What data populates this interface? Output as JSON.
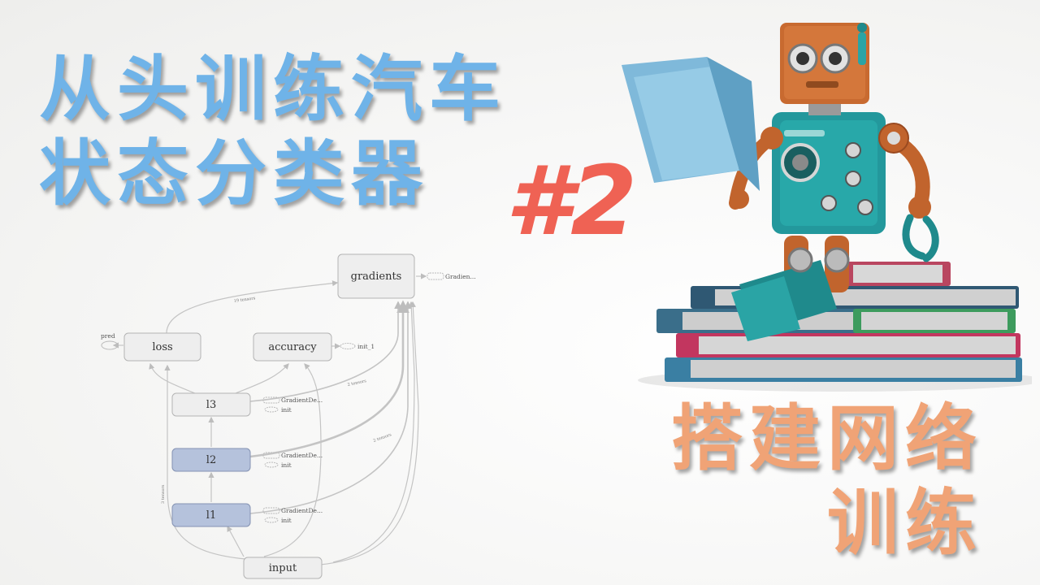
{
  "title": {
    "line1": "从头训练汽车",
    "line2": "状态分类器"
  },
  "episode": "#2",
  "subtitle": {
    "line1": "搭建网络",
    "line2": "训练"
  },
  "graph": {
    "nodes": {
      "gradients": "gradients",
      "loss": "loss",
      "accuracy": "accuracy",
      "l3": "l3",
      "l2": "l2",
      "l1": "l1",
      "input": "input"
    },
    "aux": {
      "pred": "pred",
      "gradients_out": "Gradien...",
      "init_1": "init_1",
      "l3_grad": "GradientDe...",
      "l3_init": "init",
      "l2_grad": "GradientDe...",
      "l2_init": "init",
      "l1_grad": "GradientDe...",
      "l1_init": "init"
    },
    "edge_labels": {
      "loss_gradients": "19 tensors",
      "input_loss": "3 tensors",
      "l3_gradients": "2 tensors",
      "l2_gradients": "2 tensors"
    },
    "colors": {
      "plain_node": "#eeeeee",
      "highlight_node": "#b5c2dc",
      "edge": "#bdbdbd"
    }
  },
  "robot_icon": "robot-reading-book-icon",
  "books_icon": "book-stack-icon"
}
